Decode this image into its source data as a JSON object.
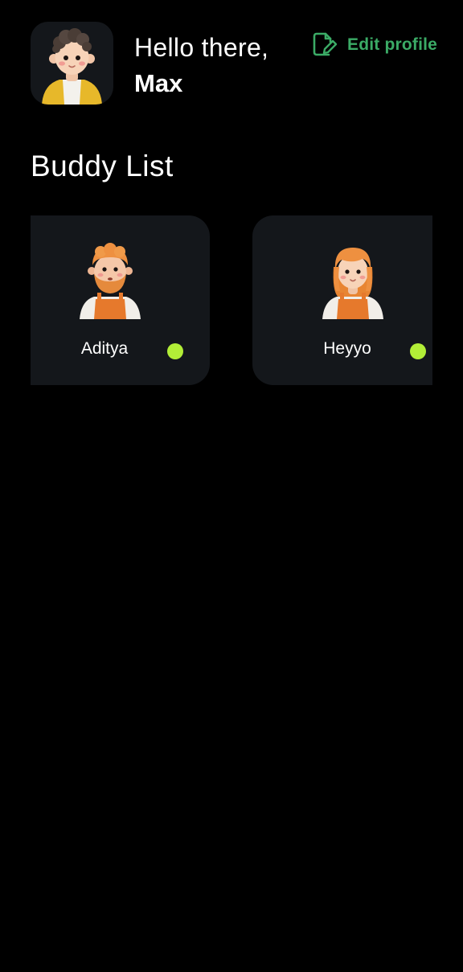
{
  "header": {
    "greeting": "Hello there,",
    "user_name": "Max",
    "avatar_icon": "memoji-boy-avatar-icon",
    "edit_profile": {
      "label": "Edit profile",
      "icon": "edit-document-icon",
      "color": "#3bab66"
    }
  },
  "buddy_list": {
    "title": "Buddy List",
    "buddies": [
      {
        "name": "Aditya",
        "status": "online",
        "status_color": "#b2ee37",
        "avatar_icon": "memoji-bearded-man-avatar-icon"
      },
      {
        "name": "Heyyo",
        "status": "online",
        "status_color": "#b2ee37",
        "avatar_icon": "memoji-girl-avatar-icon"
      }
    ]
  },
  "colors": {
    "background": "#000000",
    "card": "#14171b",
    "accent": "#3bab66",
    "online": "#b2ee37"
  }
}
